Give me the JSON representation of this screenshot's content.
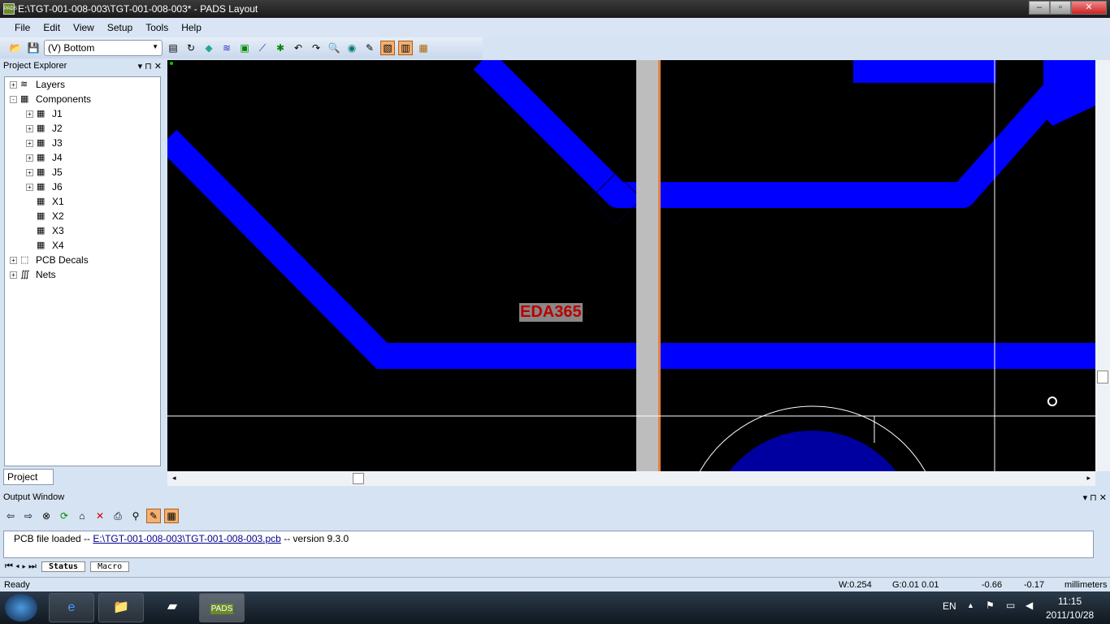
{
  "window": {
    "title": "E:\\TGT-001-008-003\\TGT-001-008-003* - PADS Layout",
    "logo": "PADS"
  },
  "menu": [
    "File",
    "Edit",
    "View",
    "Setup",
    "Tools",
    "Help"
  ],
  "toolbar": {
    "layer_select": "(V) Bottom"
  },
  "project_explorer": {
    "title": "Project Explorer",
    "tab": "Project",
    "items": [
      {
        "label": "Layers",
        "level": 0,
        "expand": "+"
      },
      {
        "label": "Components",
        "level": 0,
        "expand": "-"
      },
      {
        "label": "J1",
        "level": 1,
        "expand": "+"
      },
      {
        "label": "J2",
        "level": 1,
        "expand": "+"
      },
      {
        "label": "J3",
        "level": 1,
        "expand": "+"
      },
      {
        "label": "J4",
        "level": 1,
        "expand": "+"
      },
      {
        "label": "J5",
        "level": 1,
        "expand": "+"
      },
      {
        "label": "J6",
        "level": 1,
        "expand": "+"
      },
      {
        "label": "X1",
        "level": 1,
        "expand": ""
      },
      {
        "label": "X2",
        "level": 1,
        "expand": ""
      },
      {
        "label": "X3",
        "level": 1,
        "expand": ""
      },
      {
        "label": "X4",
        "level": 1,
        "expand": ""
      },
      {
        "label": "PCB Decals",
        "level": 0,
        "expand": "+"
      },
      {
        "label": "Nets",
        "level": 0,
        "expand": "+"
      }
    ]
  },
  "canvas": {
    "label": "EDA365",
    "trace_color": "#0000ff",
    "pad_color": "#0000a0"
  },
  "output": {
    "title": "Output Window",
    "prefix": "PCB file loaded -- ",
    "link": "E:\\TGT-001-008-003\\TGT-001-008-003.pcb",
    "suffix": "  -- version 9.3.0",
    "tabs": [
      "Status",
      "Macro"
    ]
  },
  "status": {
    "text": "Ready",
    "width": "W:0.254",
    "grid": "G:0.01 0.01",
    "x": "-0.66",
    "y": "-0.17",
    "units": "millimeters"
  },
  "taskbar": {
    "lang": "EN",
    "time": "11:15",
    "date": "2011/10/28",
    "app": "PADS"
  }
}
